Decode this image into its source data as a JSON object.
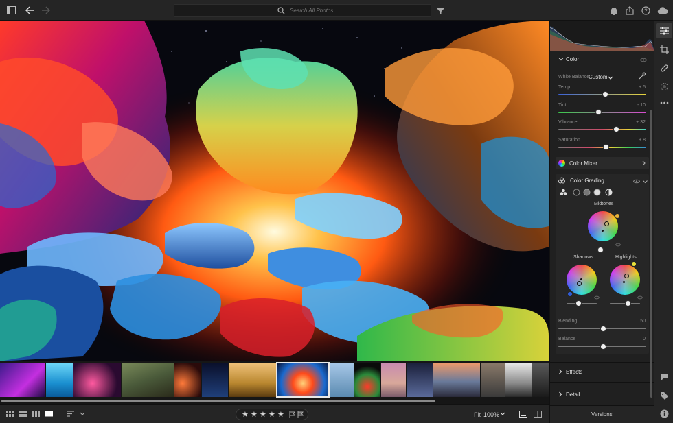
{
  "search": {
    "placeholder": "Search All Photos"
  },
  "icons": {
    "panel_toggle": "panel-toggle-icon",
    "back": "back-arrow-icon",
    "forward": "forward-arrow-icon",
    "search": "search-icon",
    "filter": "filter-icon",
    "bell": "bell-icon",
    "share": "share-icon",
    "help": "help-icon",
    "cloud": "cloud-icon"
  },
  "panel": {
    "color_section": {
      "title": "Color",
      "white_balance_label": "White Balance",
      "white_balance_value": "Custom",
      "sliders": [
        {
          "label": "Temp",
          "display": "+ 5",
          "value": 5
        },
        {
          "label": "Tint",
          "display": "- 10",
          "value": -10
        },
        {
          "label": "Vibrance",
          "display": "+ 32",
          "value": 32
        },
        {
          "label": "Saturation",
          "display": "+ 8",
          "value": 8
        }
      ]
    },
    "color_mixer": {
      "title": "Color Mixer"
    },
    "color_grading": {
      "title": "Color Grading",
      "midtones_label": "Midtones",
      "shadows_label": "Shadows",
      "highlights_label": "Highlights",
      "blending_label": "Blending",
      "blending_value": "50",
      "balance_label": "Balance",
      "balance_value": "0"
    },
    "effects": {
      "title": "Effects"
    },
    "detail": {
      "title": "Detail"
    },
    "versions_label": "Versions"
  },
  "bottombar": {
    "fit_label": "Fit",
    "zoom_value": "100%",
    "star_glyph": "★"
  },
  "colors": {
    "accent": "#4aa3ff",
    "panel_bg": "#202020",
    "topbar_bg": "#252525",
    "selected_outline": "#e8e8e8"
  }
}
